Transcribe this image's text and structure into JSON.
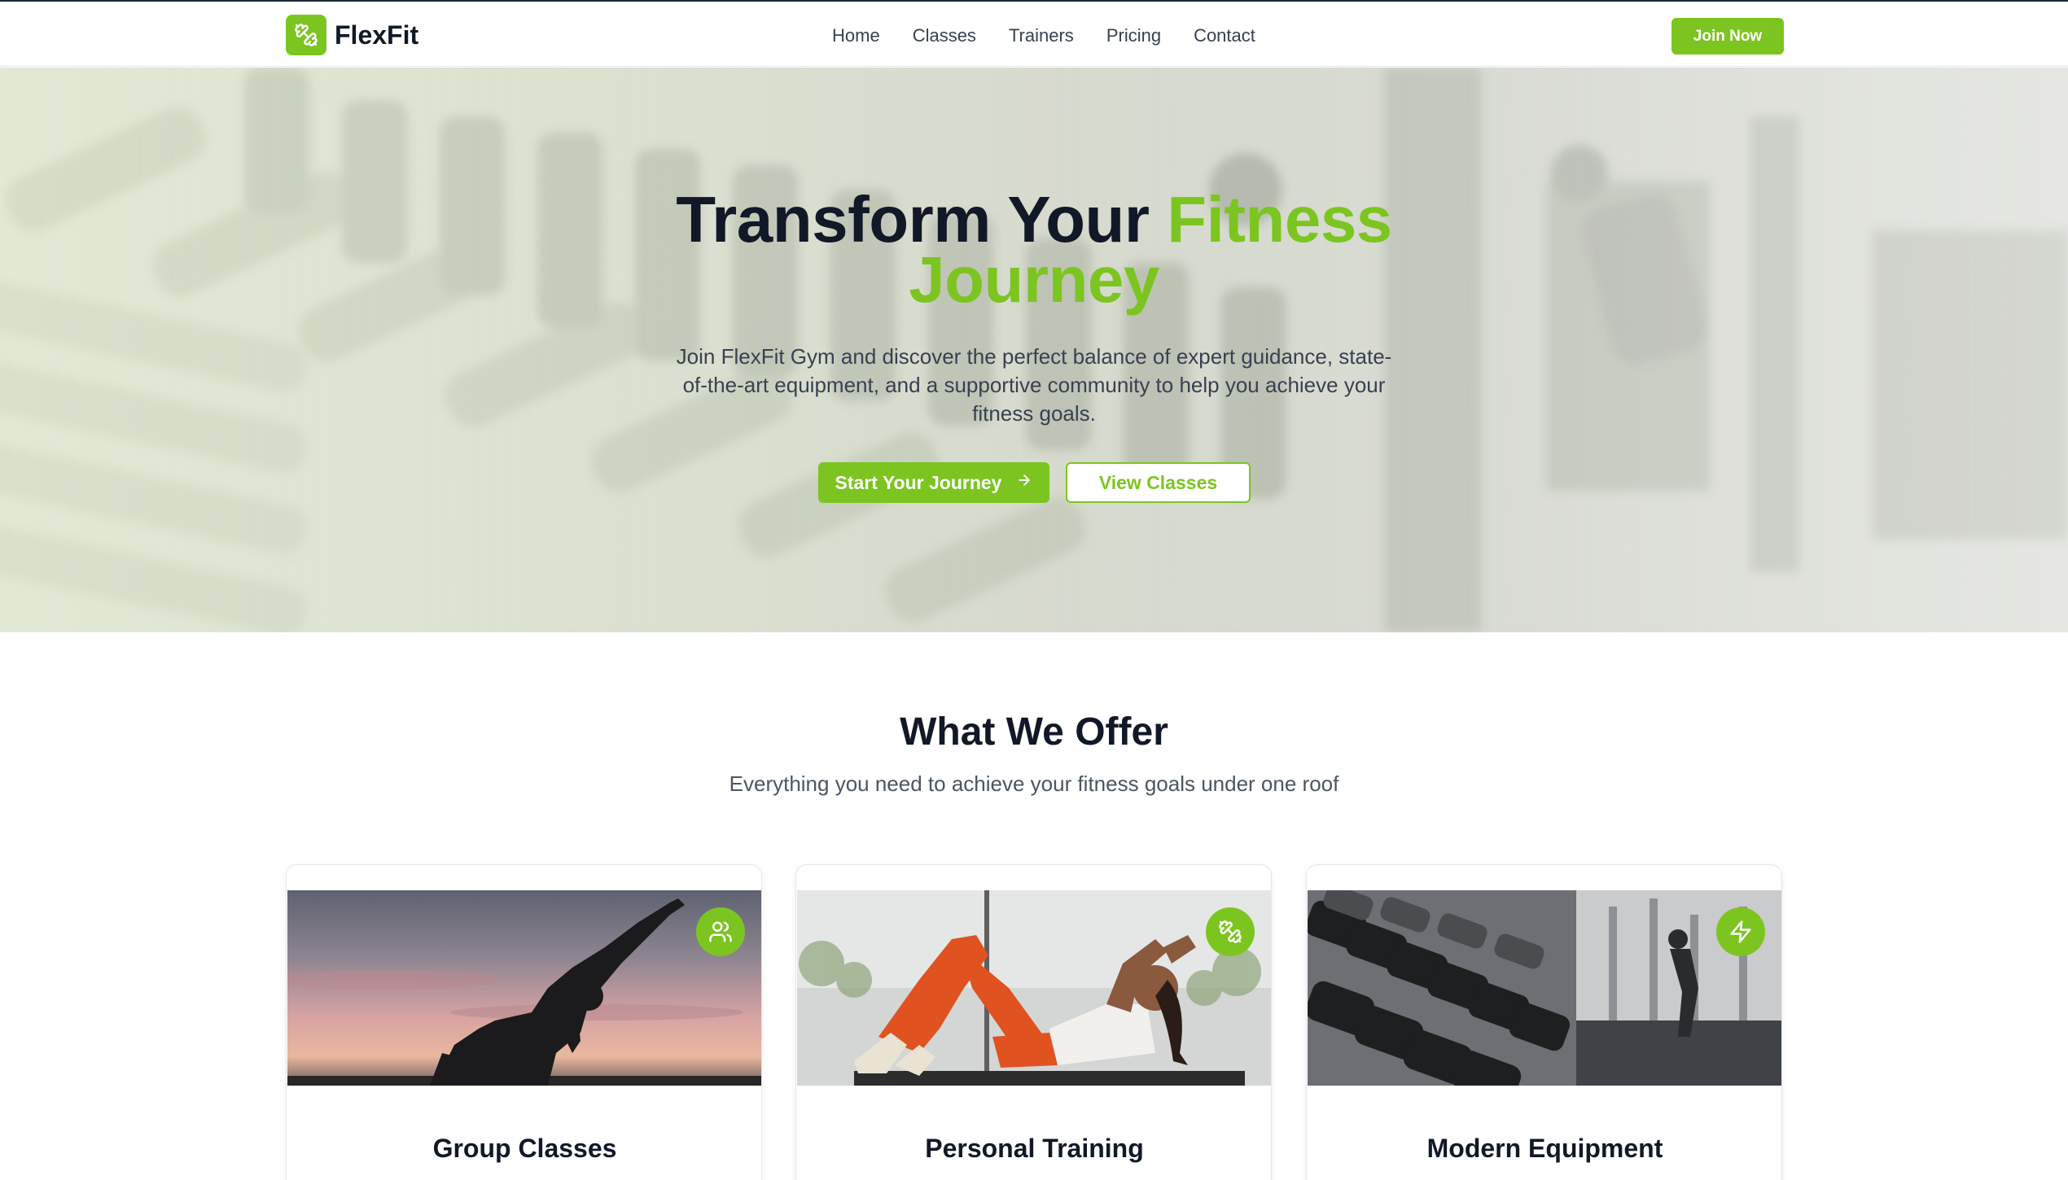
{
  "brand": {
    "name": "FlexFit",
    "accent_color": "#7cc520",
    "logo_icon": "dumbbell-icon"
  },
  "nav": {
    "links": [
      "Home",
      "Classes",
      "Trainers",
      "Pricing",
      "Contact"
    ],
    "cta_label": "Join Now"
  },
  "hero": {
    "title_part1": "Transform Your ",
    "title_highlight_1": "Fitness",
    "title_highlight_2": "Journey",
    "subtitle": "Join FlexFit Gym and discover the perfect balance of expert guidance, state-of-the-art equipment, and a supportive community to help you achieve your fitness goals.",
    "primary_button": "Start Your Journey",
    "primary_button_icon": "arrow-right-icon",
    "secondary_button": "View Classes"
  },
  "offer": {
    "title": "What We Offer",
    "subtitle": "Everything you need to achieve your fitness goals under one roof",
    "cards": [
      {
        "title": "Group Classes",
        "icon": "users-icon"
      },
      {
        "title": "Personal Training",
        "icon": "dumbbell-icon"
      },
      {
        "title": "Modern Equipment",
        "icon": "lightning-icon"
      }
    ]
  }
}
